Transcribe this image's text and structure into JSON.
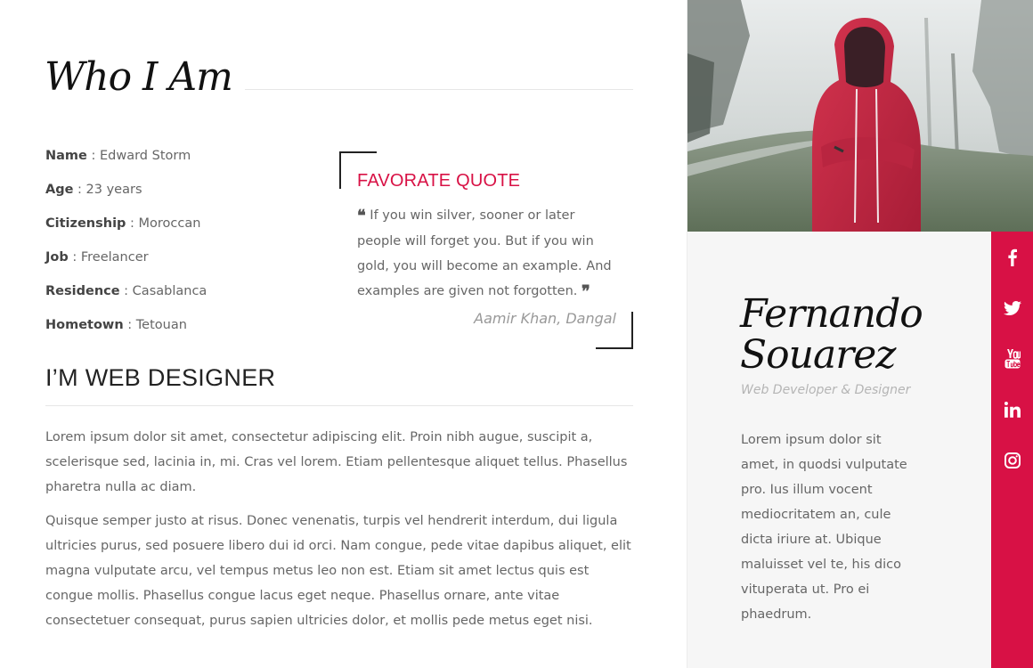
{
  "about": {
    "title": "Who I Am",
    "info": [
      {
        "key": "Name",
        "value": " : Edward Storm"
      },
      {
        "key": "Age",
        "value": " : 23 years"
      },
      {
        "key": "Citizenship",
        "value": " : Moroccan"
      },
      {
        "key": "Job",
        "value": " : Freelancer"
      },
      {
        "key": "Residence",
        "value": " : Casablanca"
      },
      {
        "key": "Hometown",
        "value": " : Tetouan"
      }
    ],
    "quote": {
      "heading": "FAVORATE QUOTE",
      "text": "If you win silver, sooner or later people will forget you. But if you win gold, you will become an example. And examples are given not forgotten.",
      "author": "Aamir Khan, Dangal"
    },
    "designer_heading": "I’M WEB DESIGNER",
    "paragraphs": [
      "Lorem ipsum dolor sit amet, consectetur adipiscing elit. Proin nibh augue, suscipit a, scelerisque sed, lacinia in, mi. Cras vel lorem. Etiam pellentesque aliquet tellus. Phasellus pharetra nulla ac diam.",
      "Quisque semper justo at risus. Donec venenatis, turpis vel hendrerit interdum, dui ligula ultricies purus, sed posuere libero dui id orci. Nam congue, pede vitae dapibus aliquet, elit magna vulputate arcu, vel tempus metus leo non est. Etiam sit amet lectus quis est congue mollis. Phasellus congue lacus eget neque. Phasellus ornare, ante vitae consectetuer consequat, purus sapien ultricies dolor, et mollis pede metus eget nisi."
    ]
  },
  "profile": {
    "first_name": "Fernando",
    "last_name": "Souarez",
    "role": "Web Developer & Designer",
    "bio": "Lorem ipsum dolor sit amet, in quodsi vulputate pro. Ius illum vocent mediocritatem an, cule dicta iriure at. Ubique maluisset vel te, his dico vituperata ut. Pro ei phaedrum.",
    "social": [
      "facebook-icon",
      "twitter-icon",
      "youtube-icon",
      "linkedin-icon",
      "instagram-icon"
    ]
  },
  "colors": {
    "accent": "#d81145",
    "heading": "#111111",
    "text": "#666666",
    "muted": "#b5b5b5"
  }
}
